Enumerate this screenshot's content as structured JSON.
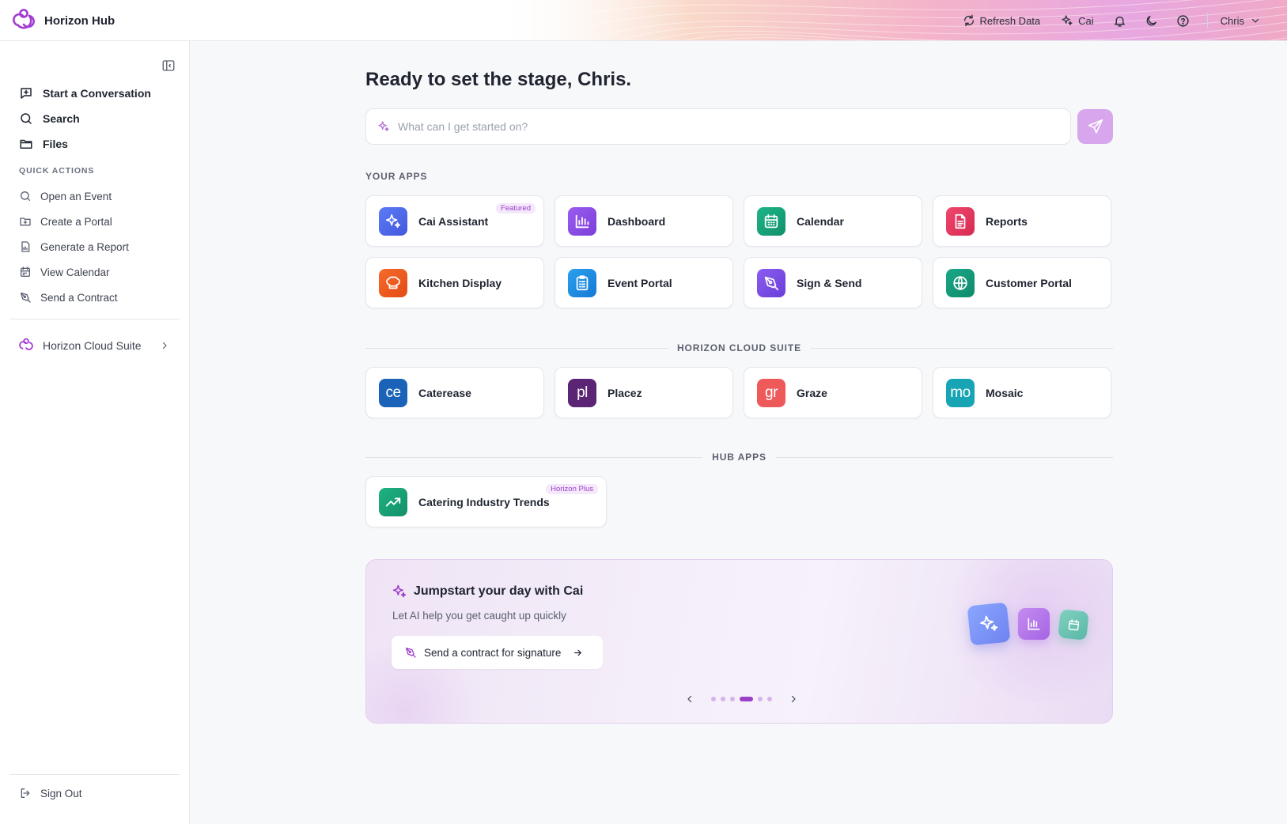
{
  "app": {
    "name": "Horizon Hub"
  },
  "topbar": {
    "refresh_label": "Refresh Data",
    "cai_label": "Cai",
    "user_name": "Chris"
  },
  "sidebar": {
    "main_items": [
      {
        "label": "Start a Conversation",
        "icon": "chat-plus-icon"
      },
      {
        "label": "Search",
        "icon": "search-icon"
      },
      {
        "label": "Files",
        "icon": "folder-icon"
      }
    ],
    "quick_actions_label": "QUICK ACTIONS",
    "quick_actions": [
      {
        "label": "Open an Event",
        "icon": "search-icon"
      },
      {
        "label": "Create a Portal",
        "icon": "folder-plus-icon"
      },
      {
        "label": "Generate a Report",
        "icon": "report-icon"
      },
      {
        "label": "View Calendar",
        "icon": "calendar-icon"
      },
      {
        "label": "Send a Contract",
        "icon": "pen-icon"
      }
    ],
    "suite_label": "Horizon Cloud Suite",
    "sign_out_label": "Sign Out"
  },
  "main": {
    "greeting": "Ready to set the stage, Chris.",
    "prompt_placeholder": "What can I get started on?",
    "your_apps_label": "YOUR APPS",
    "your_apps": [
      {
        "name": "Cai Assistant",
        "badge": "Featured",
        "icon": "sparkle-icon",
        "color": "#4f6df0"
      },
      {
        "name": "Dashboard",
        "icon": "bar-chart-icon",
        "color": "#8b4fe0"
      },
      {
        "name": "Calendar",
        "icon": "calendar-icon",
        "color": "#18a37a"
      },
      {
        "name": "Reports",
        "icon": "document-icon",
        "color": "#e8365f"
      },
      {
        "name": "Kitchen Display",
        "icon": "chef-hat-icon",
        "color": "#f0561f"
      },
      {
        "name": "Event Portal",
        "icon": "clipboard-icon",
        "color": "#1b8fe0"
      },
      {
        "name": "Sign & Send",
        "icon": "pen-icon",
        "color": "#7a4fe0"
      },
      {
        "name": "Customer Portal",
        "icon": "globe-icon",
        "color": "#139a7c"
      }
    ],
    "cloud_suite_label": "HORIZON CLOUD SUITE",
    "cloud_suite": [
      {
        "name": "Caterease",
        "mono": "ce",
        "color": "#1b63b8"
      },
      {
        "name": "Placez",
        "mono": "pl",
        "color": "#5b2475"
      },
      {
        "name": "Graze",
        "mono": "gr",
        "color": "#ee5a5a"
      },
      {
        "name": "Mosaic",
        "mono": "mo",
        "color": "#17a4b5"
      }
    ],
    "hub_apps_label": "HUB APPS",
    "hub_apps": [
      {
        "name": "Catering Industry Trends",
        "badge": "Horizon Plus",
        "icon": "trend-up-icon",
        "color": "#179a72"
      }
    ]
  },
  "promo": {
    "title": "Jumpstart your day with Cai",
    "subtitle": "Let AI help you get caught up quickly",
    "action_label": "Send a contract for signature",
    "slides_total": 7,
    "active_slide": 3
  },
  "colors": {
    "accent": "#9b3fc9",
    "send_button": "#d7a6ec"
  }
}
